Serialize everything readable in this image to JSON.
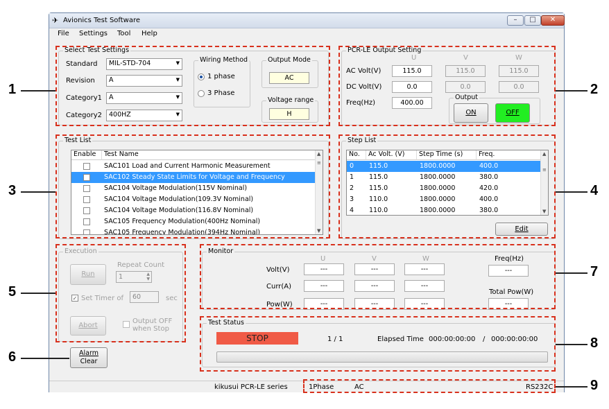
{
  "window": {
    "title": "Avionics Test Software",
    "min": "–",
    "max": "□",
    "close": "✕"
  },
  "menu": [
    "File",
    "Settings",
    "Tool",
    "Help"
  ],
  "select_settings": {
    "label": "Select Test Settings",
    "standard_label": "Standard",
    "standard": "MIL-STD-704",
    "revision_label": "Revision",
    "revision": "A",
    "category1_label": "Category1",
    "category1": "A",
    "category2_label": "Category2",
    "category2": "400HZ",
    "wiring_label": "Wiring Method",
    "wiring_1": "1 phase",
    "wiring_3": "3 Phase",
    "output_mode_label": "Output Mode",
    "output_mode": "AC",
    "voltage_range_label": "Voltage range",
    "voltage_range": "H"
  },
  "pcr_output": {
    "label": "PCR-LE Output Setting",
    "col_u": "U",
    "col_v": "V",
    "col_w": "W",
    "ac_volt_label": "AC Volt(V)",
    "ac_u": "115.0",
    "ac_v": "115.0",
    "ac_w": "115.0",
    "dc_volt_label": "DC Volt(V)",
    "dc_u": "0.0",
    "dc_v": "0.0",
    "dc_w": "0.0",
    "freq_label": "Freq(Hz)",
    "freq": "400.00",
    "output_label": "Output",
    "on": "ON",
    "off": "OFF"
  },
  "test_list": {
    "label": "Test List",
    "headers": [
      "Enable",
      "Test Name"
    ],
    "rows": [
      {
        "name": "SAC101  Load and Current Harmonic Measurement",
        "selected": false
      },
      {
        "name": "SAC102  Steady State Limits for Voltage and Frequency",
        "selected": true
      },
      {
        "name": "SAC104  Voltage Modulation(115V Nominal)",
        "selected": false
      },
      {
        "name": "SAC104  Voltage Modulation(109.3V Nominal)",
        "selected": false
      },
      {
        "name": "SAC104  Voltage Modulation(116.8V Nominal)",
        "selected": false
      },
      {
        "name": "SAC105  Frequency Modulation(400Hz Nominal)",
        "selected": false
      },
      {
        "name": "SAC105  Frequency Modulation(394Hz Nominal)",
        "selected": false
      }
    ]
  },
  "step_list": {
    "label": "Step List",
    "headers": [
      "No.",
      "Ac Volt. (V)",
      "Step Time (s)",
      "Freq."
    ],
    "rows": [
      [
        "0",
        "115.0",
        "1800.0000",
        "400.0"
      ],
      [
        "1",
        "115.0",
        "1800.0000",
        "380.0"
      ],
      [
        "2",
        "115.0",
        "1800.0000",
        "420.0"
      ],
      [
        "3",
        "110.0",
        "1800.0000",
        "400.0"
      ],
      [
        "4",
        "110.0",
        "1800.0000",
        "380.0"
      ]
    ],
    "edit": "Edit"
  },
  "execution": {
    "label": "Execution",
    "run": "Run",
    "repeat_label": "Repeat Count",
    "repeat": "1",
    "set_timer": "Set Timer of",
    "timer": "60",
    "sec": "sec",
    "abort": "Abort",
    "output_off": "Output OFF",
    "when_stop": "when Stop"
  },
  "monitor": {
    "label": "Monitor",
    "col_u": "U",
    "col_v": "V",
    "col_w": "W",
    "volt_label": "Volt(V)",
    "curr_label": "Curr(A)",
    "pow_label": "Pow(W)",
    "dash": "---",
    "freq_label": "Freq(Hz)",
    "total_pow_label": "Total Pow(W)"
  },
  "test_status": {
    "label": "Test Status",
    "state": "STOP",
    "progress": "1  /  1",
    "elapsed_label": "Elapsed Time",
    "elapsed": "000:00:00:00",
    "sep": "/",
    "total": "000:00:00:00"
  },
  "alarm_clear": [
    "Alarm",
    "Clear"
  ],
  "statusbar": {
    "series": "kikusui PCR-LE series",
    "phase": "1Phase",
    "mode": "AC",
    "port": "RS232C"
  },
  "callouts": [
    "1",
    "2",
    "3",
    "4",
    "5",
    "6",
    "7",
    "8",
    "9"
  ],
  "colors": {
    "highlight": "#d8301c",
    "selection": "#3399ff",
    "stop": "#f05a46",
    "off": "#22ee22"
  }
}
